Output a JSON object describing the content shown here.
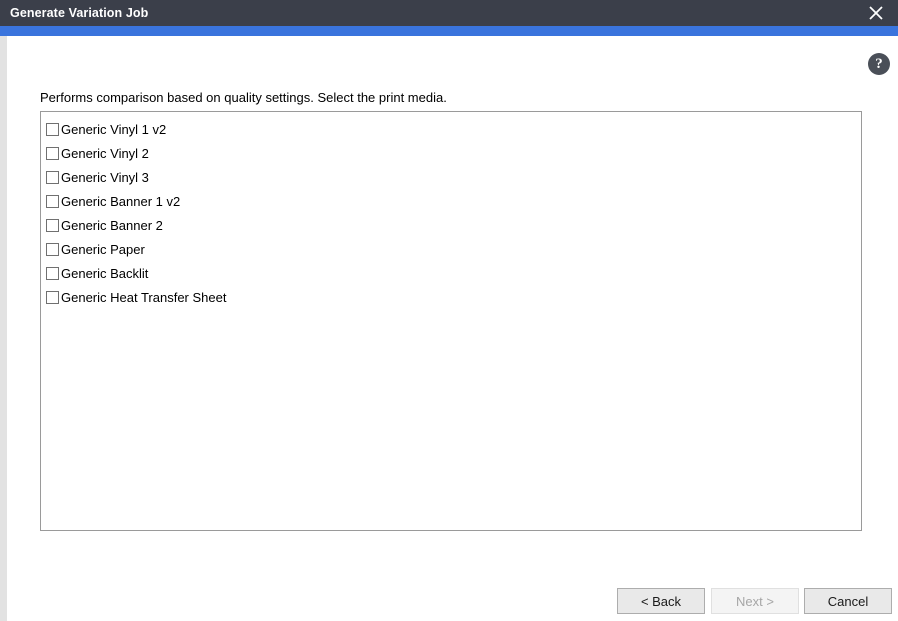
{
  "window": {
    "title": "Generate Variation Job",
    "close_icon": "close-icon"
  },
  "help": {
    "icon": "help-icon",
    "glyph": "?"
  },
  "main": {
    "instruction": "Performs comparison based on quality settings. Select the print media.",
    "media_list": [
      {
        "label": "Generic Vinyl 1 v2",
        "checked": false
      },
      {
        "label": "Generic Vinyl 2",
        "checked": false
      },
      {
        "label": "Generic Vinyl 3",
        "checked": false
      },
      {
        "label": "Generic Banner 1 v2",
        "checked": false
      },
      {
        "label": "Generic Banner 2",
        "checked": false
      },
      {
        "label": "Generic Paper",
        "checked": false
      },
      {
        "label": "Generic Backlit",
        "checked": false
      },
      {
        "label": "Generic Heat Transfer Sheet",
        "checked": false
      }
    ]
  },
  "footer": {
    "back_label": "< Back",
    "next_label": "Next >",
    "cancel_label": "Cancel",
    "next_disabled": true
  },
  "colors": {
    "titlebar": "#3b3f4a",
    "accent": "#3a74dd",
    "listbox_border": "#9a9a9a",
    "button_face": "#e9e9e9"
  }
}
